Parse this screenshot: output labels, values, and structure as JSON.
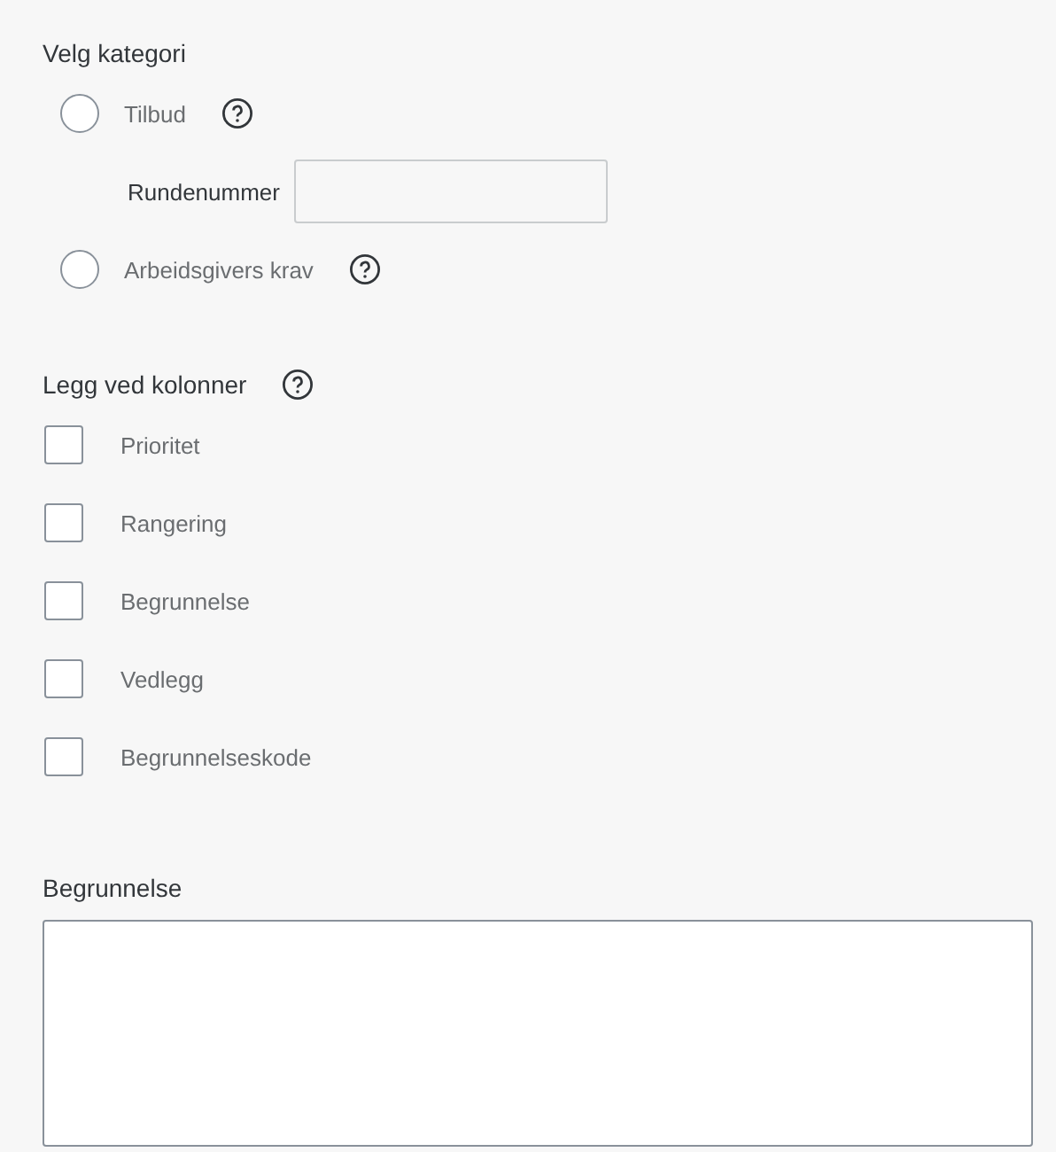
{
  "category": {
    "title": "Velg kategori",
    "options": [
      {
        "label": "Tilbud",
        "selected": false,
        "help": true,
        "field": {
          "label": "Rundenummer"
        }
      },
      {
        "label": "Arbeidsgivers krav",
        "selected": false,
        "help": true
      }
    ]
  },
  "columns": {
    "title": "Legg ved kolonner",
    "help": true,
    "items": [
      {
        "label": "Prioritet",
        "checked": false
      },
      {
        "label": "Rangering",
        "checked": false
      },
      {
        "label": "Begrunnelse",
        "checked": false
      },
      {
        "label": "Vedlegg",
        "checked": false
      },
      {
        "label": "Begrunnelseskode",
        "checked": false
      }
    ]
  },
  "reason": {
    "label": "Begrunnelse"
  }
}
